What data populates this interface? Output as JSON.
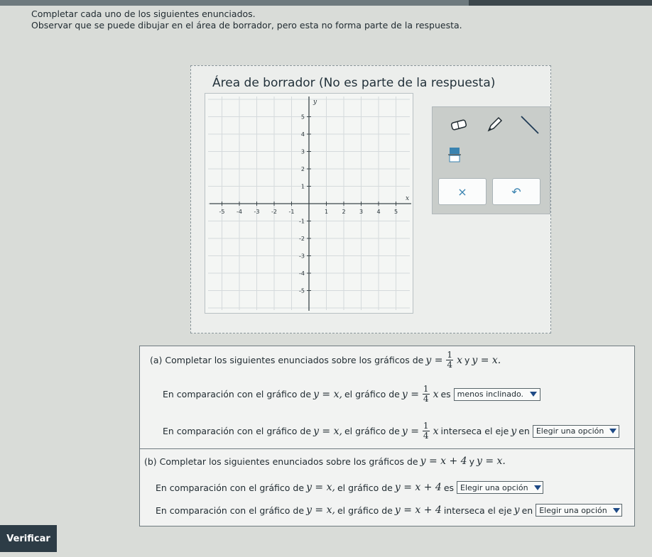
{
  "intro": {
    "line1": "Completar cada uno de los siguientes enunciados.",
    "line2": "Observar que se puede dibujar en el área de borrador, pero esta no forma parte de la respuesta."
  },
  "scratch": {
    "title": "Área de borrador (No es parte de la respuesta)",
    "plot": {
      "x_label": "x",
      "y_label": "y",
      "x_ticks": [
        "-5",
        "-4",
        "-3",
        "-2",
        "-1",
        "1",
        "2",
        "3",
        "4",
        "5"
      ],
      "y_ticks": [
        "5",
        "4",
        "3",
        "2",
        "1",
        "-1",
        "-2",
        "-3",
        "-4",
        "-5"
      ]
    },
    "tools": {
      "eraser_icon": "eraser-icon",
      "pencil_icon": "pencil-icon",
      "line_icon": "line-tool-icon",
      "fraction_icon": "fraction-icon",
      "clear_label": "×",
      "undo_label": "↶"
    }
  },
  "part_a": {
    "prompt_start": "(a) Completar los siguientes enunciados sobre los gráficos de",
    "y_eq": "y =",
    "frac_n": "1",
    "frac_d": "4",
    "x": "x",
    "and": "y",
    "y_eq_x": "y = x.",
    "s1_start": "En comparación con el gráfico de",
    "s1_yx": "y = x,",
    "s1_mid": "el gráfico de",
    "s1_end": "es",
    "s1_selected": "menos inclinado.",
    "s2_start": "En comparación con el gráfico de",
    "s2_yx": "y = x,",
    "s2_mid": "el gráfico de",
    "s2_end": "interseca el eje",
    "s2_axis": "y",
    "s2_en": "en",
    "s2_selected": "Elegir una opción"
  },
  "part_b": {
    "prompt_start": "(b) Completar los siguientes enunciados sobre los gráficos de",
    "eq1": "y = x + 4",
    "and": "y",
    "eq2": "y = x.",
    "s1_start": "En comparación con el gráfico de",
    "s1_yx": "y = x,",
    "s1_mid": "el gráfico de",
    "s1_eq": "y = x + 4",
    "s1_end": "es",
    "s1_selected": "Elegir una opción",
    "s2_start": "En comparación con el gráfico de",
    "s2_yx": "y = x,",
    "s2_mid": "el gráfico de",
    "s2_eq": "y = x + 4",
    "s2_end": "interseca el eje",
    "s2_axis": "y",
    "s2_en": "en",
    "s2_selected": "Elegir una opción"
  },
  "verify_label": "Verificar"
}
